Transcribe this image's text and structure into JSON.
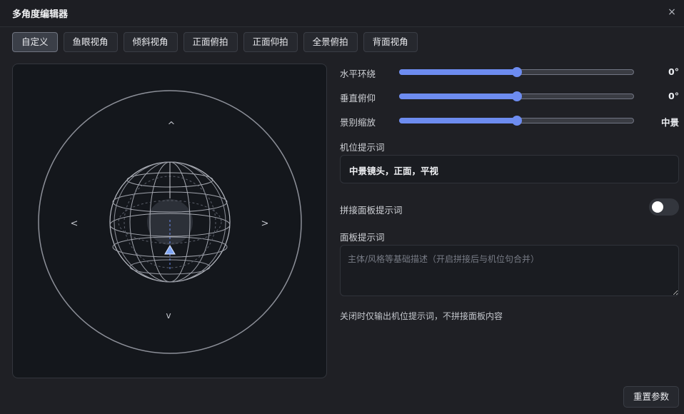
{
  "dialog": {
    "title": "多角度编辑器",
    "close_icon": "×"
  },
  "presets": [
    {
      "label": "自定义",
      "active": true
    },
    {
      "label": "鱼眼视角",
      "active": false
    },
    {
      "label": "倾斜视角",
      "active": false
    },
    {
      "label": "正面俯拍",
      "active": false
    },
    {
      "label": "正面仰拍",
      "active": false
    },
    {
      "label": "全景俯拍",
      "active": false
    },
    {
      "label": "背面视角",
      "active": false
    }
  ],
  "viewport": {
    "arrow_up": "^",
    "arrow_down": "v",
    "arrow_left": "<",
    "arrow_right": ">",
    "camera_icon": "triangle-camera-marker-icon"
  },
  "sliders": [
    {
      "label": "水平环绕",
      "value_text": "0°",
      "fraction": 0.5
    },
    {
      "label": "垂直俯仰",
      "value_text": "0°",
      "fraction": 0.5
    },
    {
      "label": "景别缩放",
      "value_text": "中景",
      "fraction": 0.5
    }
  ],
  "camera_prompt": {
    "label": "机位提示词",
    "value": "中景镜头，正面，平视"
  },
  "stitch_toggle": {
    "label": "拼接面板提示词",
    "on": false
  },
  "panel_prompt": {
    "label": "面板提示词",
    "value": "",
    "placeholder": "主体/风格等基础描述（开启拼接后与机位句合并）"
  },
  "hint": "关闭时仅输出机位提示词，不拼接面板内容",
  "reset_label": "重置参数",
  "colors": {
    "accent": "#6d8cf0",
    "background": "#1f2025",
    "viewport_bg": "#14171c"
  }
}
